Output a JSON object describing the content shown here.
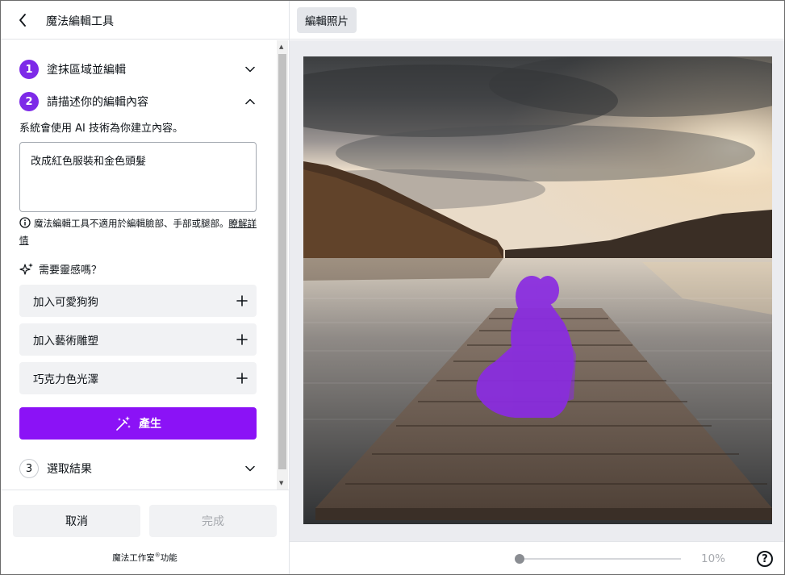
{
  "header": {
    "title": "魔法編輯工具"
  },
  "steps": [
    {
      "num": "1",
      "label": "塗抹區域並編輯",
      "state": "completed"
    },
    {
      "num": "2",
      "label": "請描述你的編輯內容",
      "state": "active"
    },
    {
      "num": "3",
      "label": "選取結果",
      "state": "pending"
    }
  ],
  "description": "系統會使用 AI 技術為你建立內容。",
  "prompt_value": "改成紅色服裝和金色頭髮",
  "note": {
    "text": "魔法編輯工具不適用於編輯臉部、手部或腿部。",
    "link": "瞭解詳情"
  },
  "inspiration": {
    "label": "需要靈感嗎？"
  },
  "suggestions": [
    {
      "label": "加入可愛狗狗"
    },
    {
      "label": "加入藝術雕塑"
    },
    {
      "label": "巧克力色光澤"
    }
  ],
  "generate_label": "產生",
  "footer": {
    "cancel": "取消",
    "done": "完成",
    "powered_by": "魔法工作室",
    "powered_sup": "®",
    "powered_suffix": "功能"
  },
  "toolbar": {
    "edit_photo": "編輯照片"
  },
  "zoom": {
    "value": "10%",
    "level": 0.1
  },
  "help_label": "?",
  "colors": {
    "accent": "#8b12f6",
    "step_active": "#7d2ae8",
    "mask": "#8a2be2"
  }
}
